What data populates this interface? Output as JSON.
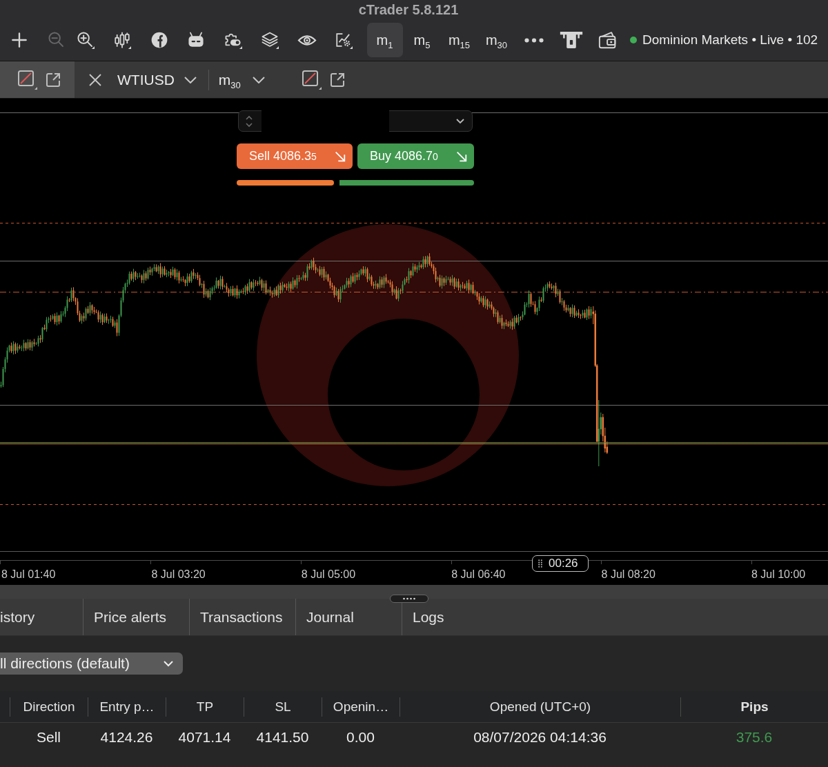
{
  "window": {
    "title": "cTrader 5.8.121"
  },
  "toolbar": {
    "tools": [
      {
        "disabled": false,
        "dropdown": false
      },
      {
        "disabled": true,
        "dropdown": false
      },
      {
        "disabled": false,
        "dropdown": true
      },
      {
        "disabled": false,
        "dropdown": true
      },
      {
        "disabled": false,
        "dropdown": false
      },
      {
        "disabled": false,
        "dropdown": false
      },
      {
        "disabled": false,
        "dropdown": true
      },
      {
        "disabled": false,
        "dropdown": true
      },
      {
        "disabled": false,
        "dropdown": false
      },
      {
        "disabled": false,
        "dropdown": true
      }
    ],
    "timeframes": [
      {
        "label": "m$_{1}$",
        "selected": true
      },
      {
        "label": "m$_{5}$",
        "selected": false
      },
      {
        "label": "m$_{15}$",
        "selected": false
      },
      {
        "label": "m$_{30}$",
        "selected": false
      }
    ],
    "account": {
      "online": true,
      "label": "Dominion Markets • Live • 102"
    }
  },
  "chart_tabs": [
    {
      "selected": true
    },
    {
      "selected": false,
      "symbol": "WTIUSD",
      "timeframe": "m$_{30}$"
    }
  ],
  "trade": {
    "quantity": {
      "redacted": true
    },
    "sell": {
      "text": "Sell 4086.3",
      "pipette": "5"
    },
    "buy": {
      "text": "Buy 4086.7",
      "pipette": "0"
    },
    "sentiment": {
      "level": 0.41
    }
  },
  "time_axis": {
    "labels": [
      "8 Jul 01:40",
      "8 Jul 03:20",
      "8 Jul 05:00",
      "8 Jul 06:40",
      "8 Jul 08:20",
      "8 Jul 10:00"
    ],
    "countdown": "00:26"
  },
  "panel": {
    "tabs": [
      {
        "label": "istory",
        "selected": false
      },
      {
        "label": "Price alerts",
        "selected": false
      },
      {
        "label": "Transactions",
        "selected": false
      },
      {
        "label": "Journal",
        "selected": false
      },
      {
        "label": "Logs",
        "selected": false
      }
    ],
    "filter": {
      "value": "ll directions (default)"
    }
  },
  "table": {
    "columns": [
      {
        "label": "Direction",
        "sorted": false
      },
      {
        "label": "Entry p…",
        "sorted": false
      },
      {
        "label": "TP",
        "sorted": false
      },
      {
        "label": "SL",
        "sorted": false
      },
      {
        "label": "Openin…",
        "sorted": false
      },
      {
        "label": "Opened (UTC+0)",
        "sorted": false
      },
      {
        "label": "Pips",
        "sorted": true
      }
    ],
    "rows": [
      {
        "cells": [
          "Sell",
          "4124.26",
          "4071.14",
          "4141.50",
          "0.00",
          "08/07/2026 04:14:36",
          "375.6"
        ],
        "pips_positive": true
      }
    ]
  }
}
